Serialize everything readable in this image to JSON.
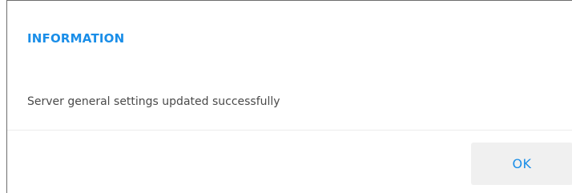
{
  "dialog": {
    "title": "INFORMATION",
    "message": "Server general settings updated successfully",
    "ok_label": "OK"
  },
  "colors": {
    "title": "#1a8ee8",
    "button_text": "#1a8ee8",
    "button_bg": "#f0f0f0",
    "message_text": "#4a4a4a",
    "divider": "#ececec"
  }
}
